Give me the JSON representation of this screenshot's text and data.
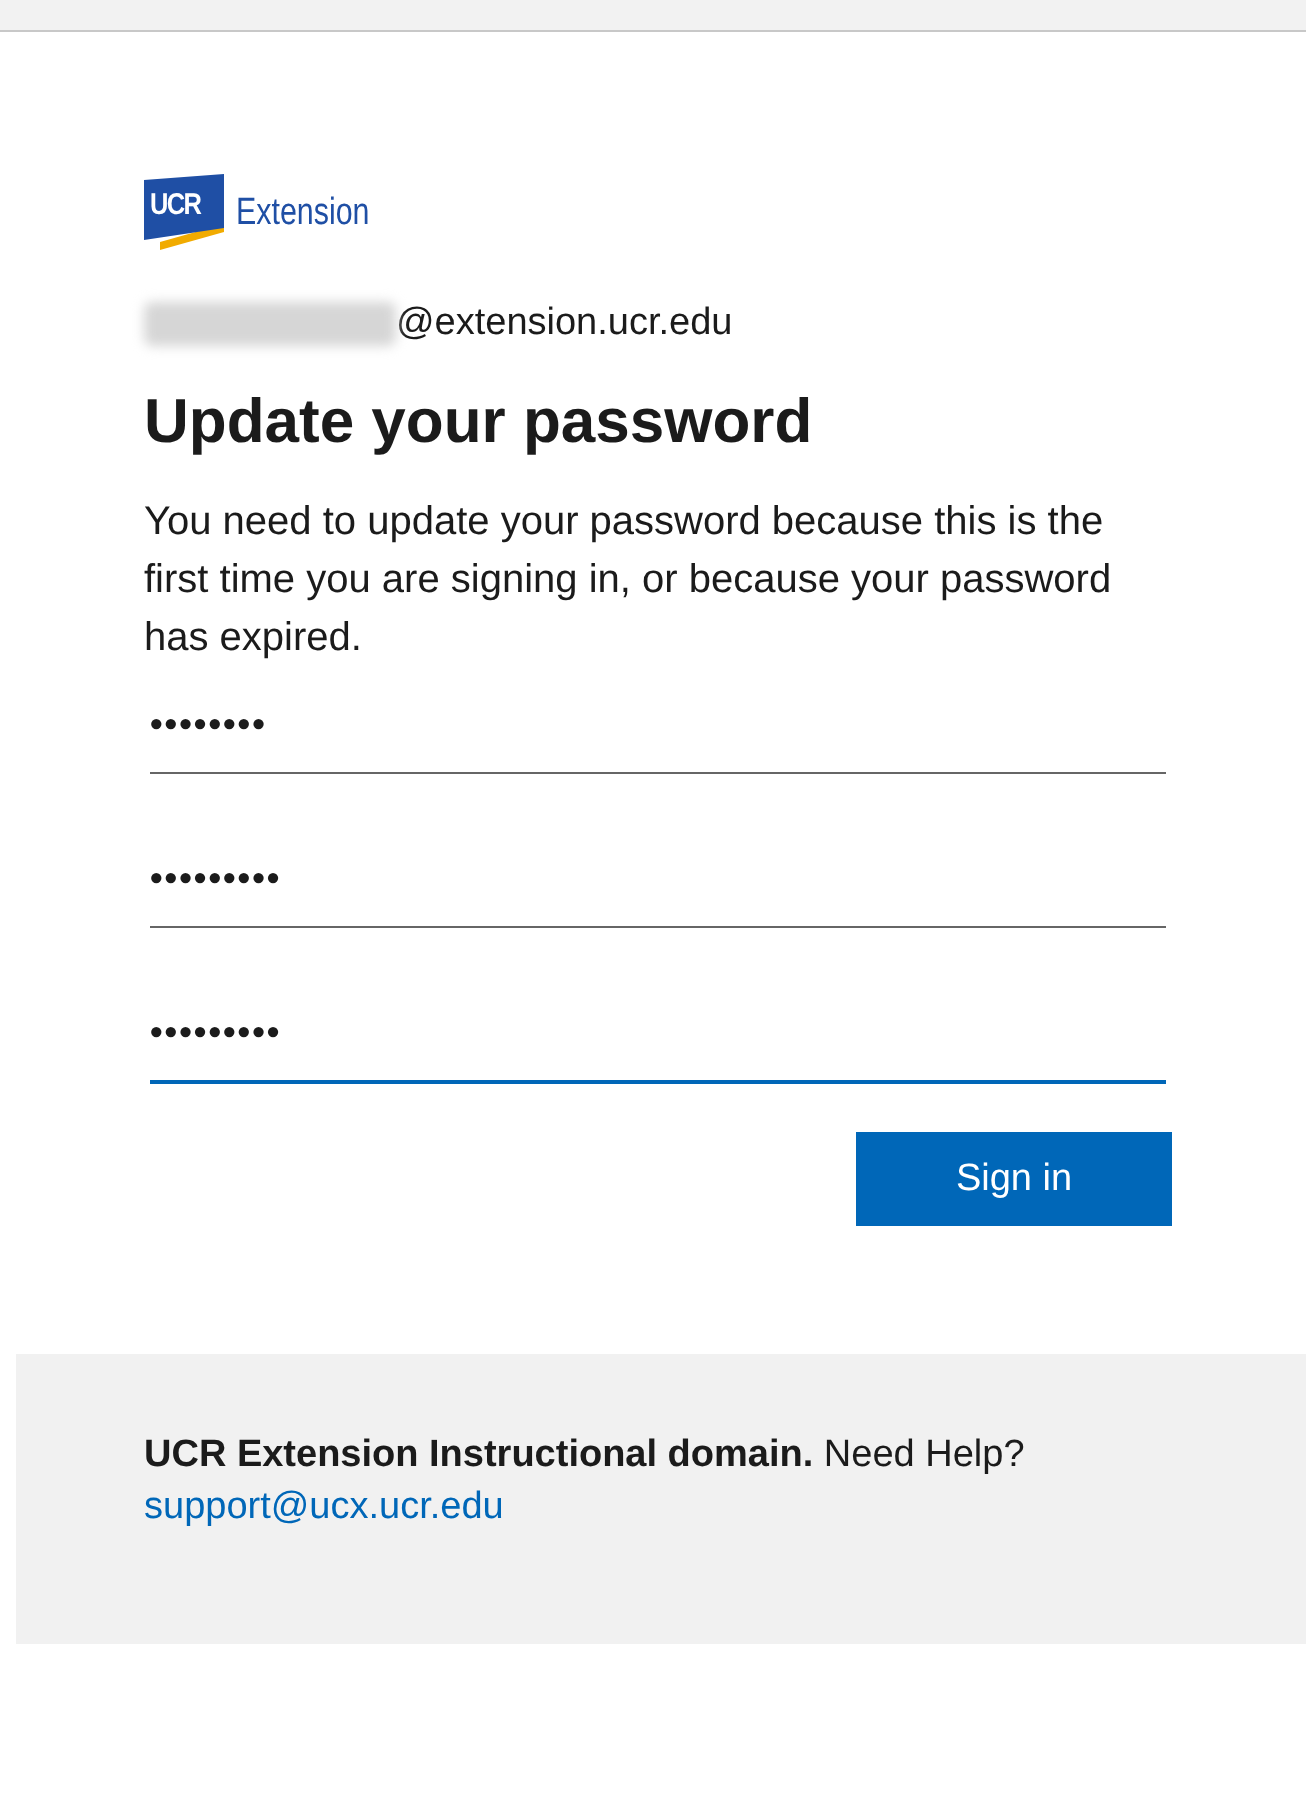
{
  "logo": {
    "mark": "UCR",
    "name": "Extension"
  },
  "account": {
    "suffix": "@extension.ucr.edu"
  },
  "title": "Update your password",
  "description": "You need to update your password because this is the first time you are signing in, or because your password has expired.",
  "fields": [
    {
      "value": "••••••••",
      "focused": false
    },
    {
      "value": "•••••••••",
      "focused": false
    },
    {
      "value": "•••••••••",
      "focused": true
    }
  ],
  "button": "Sign in",
  "footer": {
    "text": "**UCR Extension Instructional domain.** Need Help?",
    "link": "support@ucx.ucr.edu"
  }
}
